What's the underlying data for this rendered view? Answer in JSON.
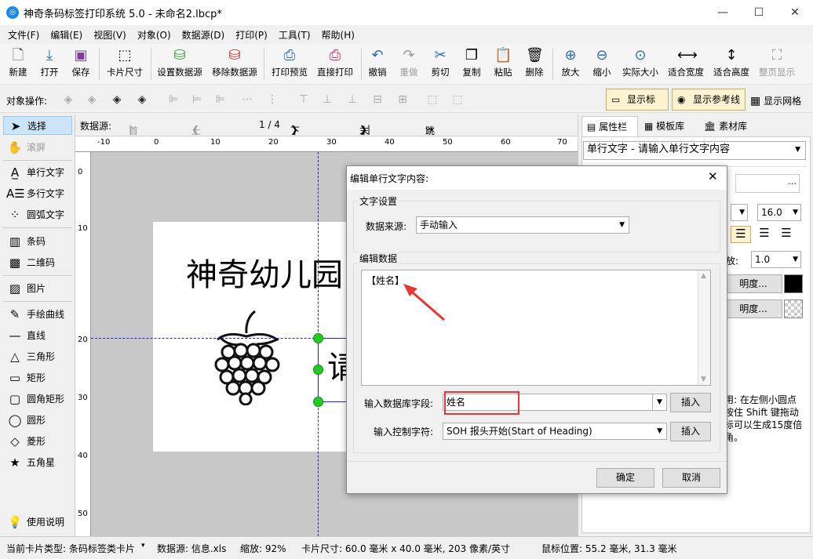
{
  "window": {
    "title": "神奇条码标签打印系统 5.0 - 未命名2.lbcp*",
    "icon": "app-icon",
    "min": "—",
    "max": "☐",
    "close": "✕"
  },
  "menu": [
    "文件(F)",
    "编辑(E)",
    "视图(V)",
    "对象(O)",
    "数据源(D)",
    "打印(P)",
    "工具(T)",
    "帮助(H)"
  ],
  "toolbar": [
    {
      "label": "新建",
      "icon": "new-file-icon"
    },
    {
      "label": "打开",
      "icon": "open-icon"
    },
    {
      "label": "保存",
      "icon": "save-icon"
    },
    {
      "label": "卡片尺寸",
      "icon": "card-size-icon"
    },
    {
      "label": "设置数据源",
      "icon": "database-add-icon"
    },
    {
      "label": "移除数据源",
      "icon": "database-remove-icon"
    },
    {
      "label": "打印预览",
      "icon": "print-preview-icon"
    },
    {
      "label": "直接打印",
      "icon": "printer-icon"
    },
    {
      "label": "撤销",
      "icon": "undo-icon"
    },
    {
      "label": "重做",
      "icon": "redo-icon"
    },
    {
      "label": "剪切",
      "icon": "cut-icon"
    },
    {
      "label": "复制",
      "icon": "copy-icon"
    },
    {
      "label": "粘贴",
      "icon": "paste-icon"
    },
    {
      "label": "删除",
      "icon": "delete-icon"
    },
    {
      "label": "放大",
      "icon": "zoom-in-icon"
    },
    {
      "label": "缩小",
      "icon": "zoom-out-icon"
    },
    {
      "label": "实际大小",
      "icon": "actual-size-icon"
    },
    {
      "label": "适合宽度",
      "icon": "fit-width-icon"
    },
    {
      "label": "适合高度",
      "icon": "fit-height-icon"
    },
    {
      "label": "整页显示",
      "icon": "full-page-icon"
    }
  ],
  "objbar": {
    "label": "对象操作:",
    "show_ruler": "显示标尺",
    "show_guides": "显示参考线",
    "show_grid": "显示网格"
  },
  "tools": [
    "选择",
    "滚屏",
    "单行文字",
    "多行文字",
    "圆弧文字",
    "条码",
    "二维码",
    "图片",
    "手绘曲线",
    "直线",
    "三角形",
    "矩形",
    "圆角矩形",
    "圆形",
    "菱形",
    "五角星",
    "使用说明"
  ],
  "nav": {
    "label": "数据源:",
    "first": "首条记录",
    "prev": "上一条记录",
    "count": "1 / 4",
    "next": "下一条记录",
    "last": "末条记录",
    "jump": "跳转到记录"
  },
  "ruler_h": [
    "-10",
    "0",
    "10",
    "20",
    "30",
    "40",
    "50",
    "60",
    "70"
  ],
  "ruler_v": [
    "0",
    "10",
    "20",
    "30",
    "40",
    "50"
  ],
  "card": {
    "title": "神奇幼儿园",
    "partial_text": "请"
  },
  "rightpanel": {
    "tabs": [
      "属性栏",
      "模板库",
      "素材库"
    ],
    "type_select": "单行文字 - 请输入单行文字内容",
    "font_size": "16.0",
    "scale": "1.0",
    "scale_label": "放:",
    "color_btn1": "明度...",
    "color_btn2": "明度...",
    "help": "用: 在左侧小圆点\n按住 Shift 键拖动\n标可以生成15度倍\n角。"
  },
  "dialog": {
    "title": "编辑单行文字内容:",
    "group_text": "文字设置",
    "source_label": "数据来源:",
    "source_value": "手动输入",
    "group_data": "编辑数据",
    "data_value": "【姓名】",
    "field_label": "输入数据库字段:",
    "field_value": "姓名",
    "ctrl_label": "输入控制字符:",
    "ctrl_value": "SOH  报头开始(Start of Heading)",
    "insert1": "插入",
    "insert2": "插入",
    "ok": "确定",
    "cancel": "取消"
  },
  "status": {
    "card_type": "当前卡片类型: 条码标签类卡片",
    "datasource": "数据源: 信息.xls",
    "zoom": "缩放: 92%",
    "card_size": "卡片尺寸: 60.0 毫米 x 40.0 毫米, 203 像素/英寸",
    "mouse": "鼠标位置: 55.2 毫米, 31.3 毫米"
  },
  "colors": {
    "highlight": "#e53935",
    "accent": "#1e88e5",
    "handle": "#22cc22"
  }
}
